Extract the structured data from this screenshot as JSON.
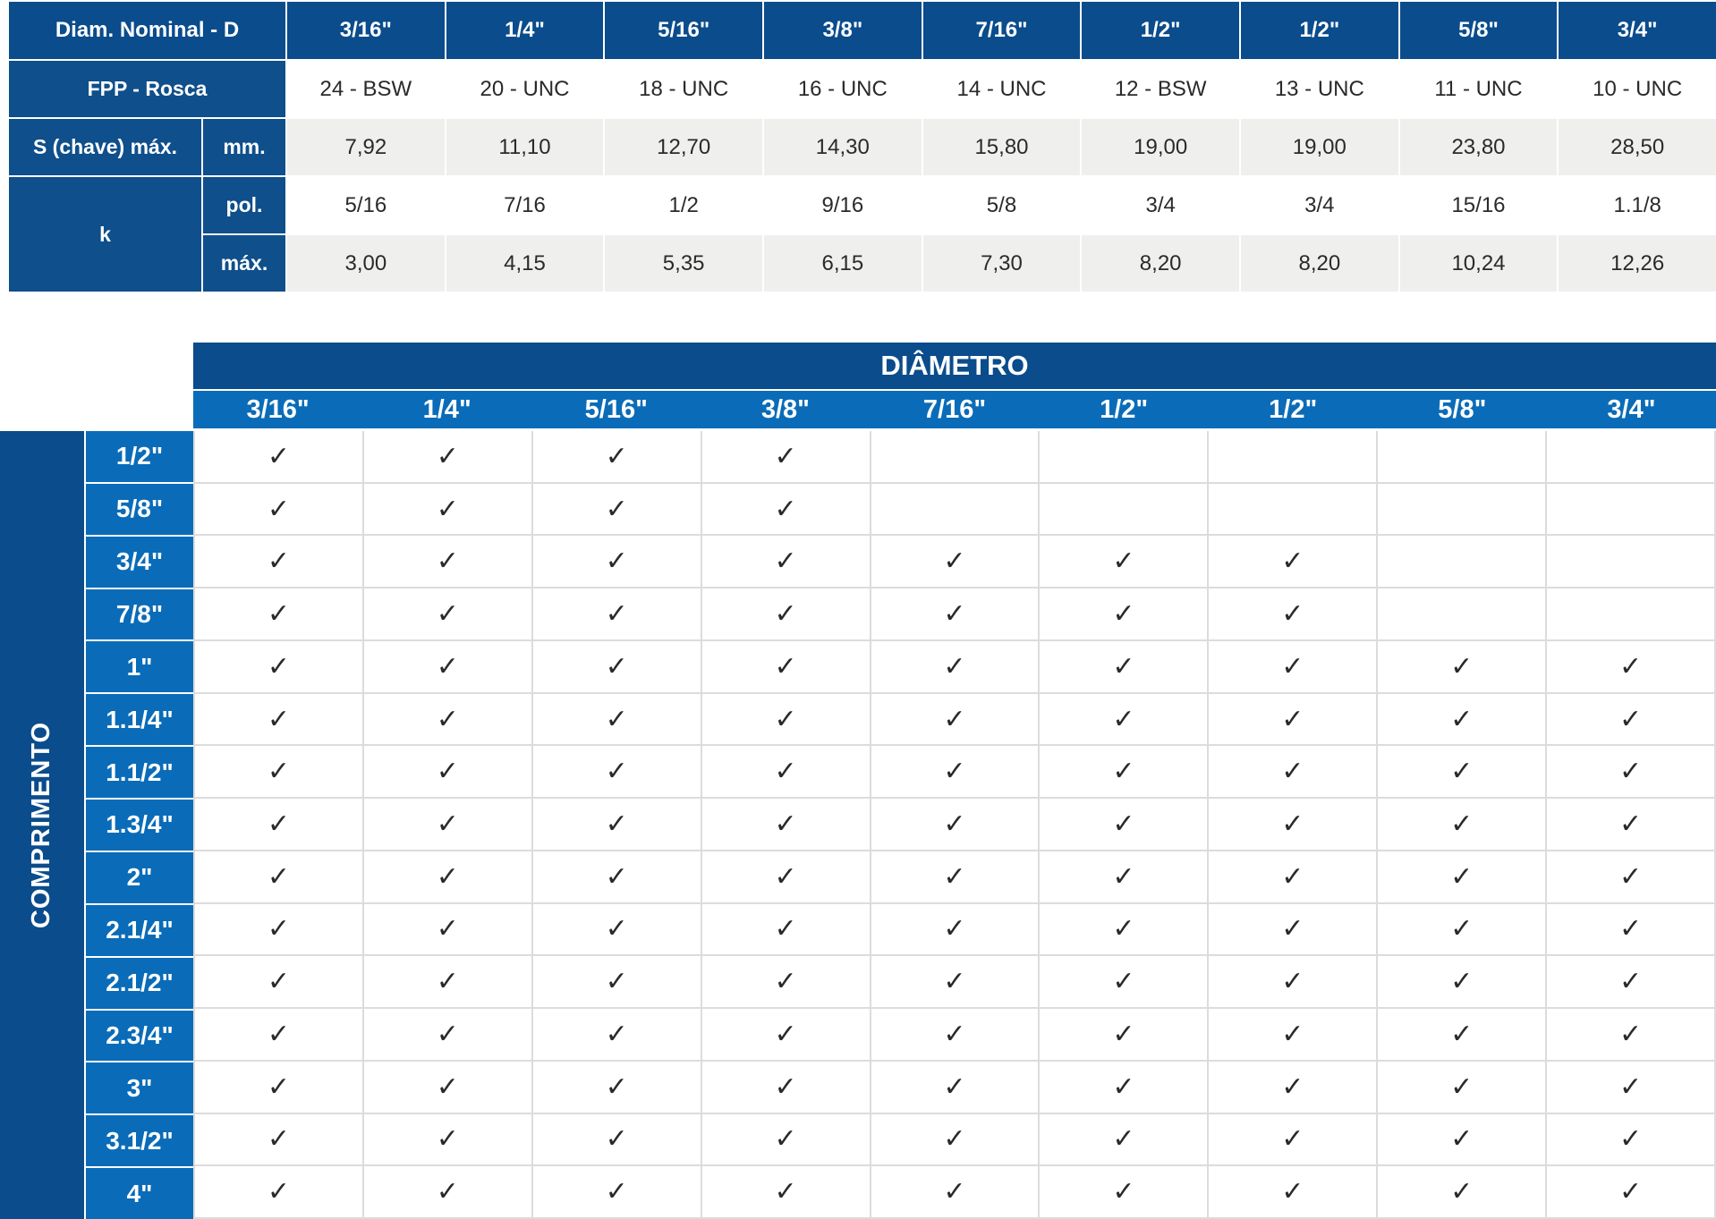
{
  "spec_table": {
    "diam_label": "Diam. Nominal - D",
    "diameters": [
      "3/16\"",
      "1/4\"",
      "5/16\"",
      "3/8\"",
      "7/16\"",
      "1/2\"",
      "1/2\"",
      "5/8\"",
      "3/4\""
    ],
    "fpp_label": "FPP - Rosca",
    "fpp": [
      "24 - BSW",
      "20 - UNC",
      "18 - UNC",
      "16 - UNC",
      "14 - UNC",
      "12 - BSW",
      "13 - UNC",
      "11 - UNC",
      "10 - UNC"
    ],
    "s_label": "S (chave) máx.",
    "s_unit": "mm.",
    "s": [
      "7,92",
      "11,10",
      "12,70",
      "14,30",
      "15,80",
      "19,00",
      "19,00",
      "23,80",
      "28,50"
    ],
    "k_label": "k",
    "k_pol_unit": "pol.",
    "k_pol": [
      "5/16",
      "7/16",
      "1/2",
      "9/16",
      "5/8",
      "3/4",
      "3/4",
      "15/16",
      "1.1/8"
    ],
    "k_max_unit": "máx.",
    "k_max": [
      "3,00",
      "4,15",
      "5,35",
      "6,15",
      "7,30",
      "8,20",
      "8,20",
      "10,24",
      "12,26"
    ]
  },
  "compat_table": {
    "title": "DIÂMETRO",
    "side_label": "COMPRIMENTO",
    "check_glyph": "✓",
    "diameters": [
      "3/16\"",
      "1/4\"",
      "5/16\"",
      "3/8\"",
      "7/16\"",
      "1/2\"",
      "1/2\"",
      "5/8\"",
      "3/4\""
    ],
    "lengths": [
      "1/2\"",
      "5/8\"",
      "3/4\"",
      "7/8\"",
      "1\"",
      "1.1/4\"",
      "1.1/2\"",
      "1.3/4\"",
      "2\"",
      "2.1/4\"",
      "2.1/2\"",
      "2.3/4\"",
      "3\"",
      "3.1/2\"",
      "4\""
    ],
    "available": [
      [
        1,
        1,
        1,
        1,
        0,
        0,
        0,
        0,
        0
      ],
      [
        1,
        1,
        1,
        1,
        0,
        0,
        0,
        0,
        0
      ],
      [
        1,
        1,
        1,
        1,
        1,
        1,
        1,
        0,
        0
      ],
      [
        1,
        1,
        1,
        1,
        1,
        1,
        1,
        0,
        0
      ],
      [
        1,
        1,
        1,
        1,
        1,
        1,
        1,
        1,
        1
      ],
      [
        1,
        1,
        1,
        1,
        1,
        1,
        1,
        1,
        1
      ],
      [
        1,
        1,
        1,
        1,
        1,
        1,
        1,
        1,
        1
      ],
      [
        1,
        1,
        1,
        1,
        1,
        1,
        1,
        1,
        1
      ],
      [
        1,
        1,
        1,
        1,
        1,
        1,
        1,
        1,
        1
      ],
      [
        1,
        1,
        1,
        1,
        1,
        1,
        1,
        1,
        1
      ],
      [
        1,
        1,
        1,
        1,
        1,
        1,
        1,
        1,
        1
      ],
      [
        1,
        1,
        1,
        1,
        1,
        1,
        1,
        1,
        1
      ],
      [
        1,
        1,
        1,
        1,
        1,
        1,
        1,
        1,
        1
      ],
      [
        1,
        1,
        1,
        1,
        1,
        1,
        1,
        1,
        1
      ],
      [
        1,
        1,
        1,
        1,
        1,
        1,
        1,
        1,
        1
      ]
    ]
  }
}
